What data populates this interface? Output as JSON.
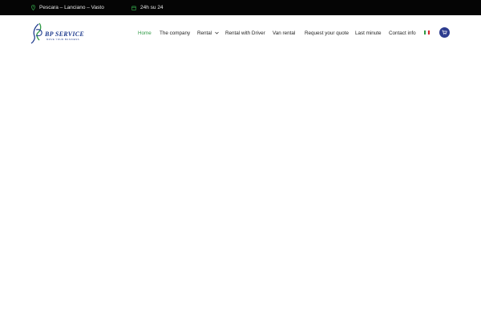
{
  "topbar": {
    "location": "Pescara – Lanciano – Vasto",
    "hours": "24h su 24",
    "background": "#050505",
    "icon_color": "#2f9a45"
  },
  "logo": {
    "brand": "BP SERVICE",
    "tagline": "move your business",
    "brand_color": "#1f3c8e"
  },
  "nav": {
    "items": [
      {
        "label": "Home",
        "active": true
      },
      {
        "label": "The company"
      },
      {
        "label": "Rental",
        "has_dropdown": true
      },
      {
        "label": "Rental with Driver"
      },
      {
        "label": "Van rental"
      },
      {
        "label": "Request your quote"
      },
      {
        "label": "Last minute"
      },
      {
        "label": "Contact info"
      }
    ],
    "active_color": "#2f9a45",
    "language_flag": "italy-flag-icon",
    "cart_icon": "cart-icon",
    "cart_button_color": "#2d3c8f"
  }
}
